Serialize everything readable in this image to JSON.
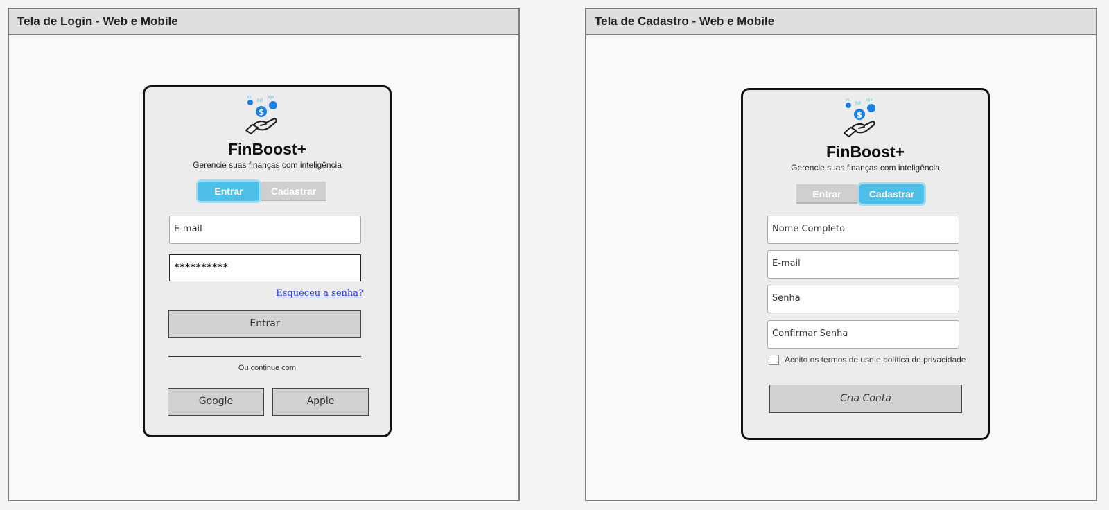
{
  "login": {
    "header_title": "Tela de Login - Web e Mobile",
    "brand": "FinBoost+",
    "tagline": "Gerencie suas finanças com inteligência",
    "tabs": {
      "login": "Entrar",
      "signup": "Cadastrar",
      "active": "login"
    },
    "email_placeholder": "E-mail",
    "password_value": "**********",
    "forgot_link": "Esqueceu a senha?",
    "submit_label": "Entrar",
    "divider_text": "Ou continue com",
    "social": {
      "google": "Google",
      "apple": "Apple"
    }
  },
  "signup": {
    "header_title": "Tela de Cadastro - Web e Mobile",
    "brand": "FinBoost+",
    "tagline": "Gerencie suas finanças com inteligência",
    "tabs": {
      "login": "Entrar",
      "signup": "Cadastrar",
      "active": "signup"
    },
    "name_placeholder": "Nome Completo",
    "email_placeholder": "E-mail",
    "password_placeholder": "Senha",
    "confirm_placeholder": "Confirmar Senha",
    "terms_label": "Aceito os termos de uso e política de privacidade",
    "terms_checked": false,
    "submit_label": "Cria Conta"
  },
  "colors": {
    "accent": "#4ebfe8",
    "logo_blue": "#1a7fe0",
    "link": "#2b3bd6",
    "card_bg": "#ececec"
  },
  "icons": [
    "hand-coin-logo-icon"
  ]
}
